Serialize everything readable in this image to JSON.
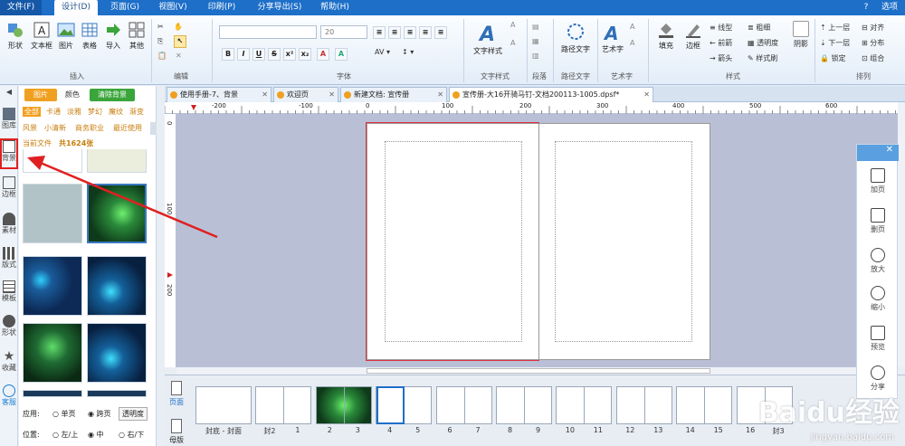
{
  "menubar": {
    "tabs": [
      "文件(F)",
      "设计(D)",
      "页面(G)",
      "视图(V)",
      "印刷(P)",
      "分享导出(S)",
      "帮助(H)"
    ],
    "right": "选项"
  },
  "ribbon": {
    "insert": {
      "buttons": [
        "形状",
        "文本框",
        "图片",
        "表格",
        "导入",
        "其他"
      ],
      "label": "插入"
    },
    "edit_label": "编辑",
    "font": {
      "size": "20",
      "label": "字体"
    },
    "text_style": {
      "button": "文字样式",
      "label": "文字样式"
    },
    "paragraph_label": "段落",
    "path_text": {
      "button": "路径文字",
      "label": "路径文字"
    },
    "art_text": {
      "button": "艺术字",
      "label": "艺术字"
    },
    "style": {
      "fill": "填充",
      "border": "边框",
      "line_type": "线型",
      "thickness": "粗细",
      "front_arrow": "前箭",
      "back_arrow": "后箭",
      "arrow": "箭头",
      "transparency": "透明度",
      "style_copy": "样式刷",
      "label": "样式"
    },
    "shadow": "阴影",
    "arrange": {
      "up": "上一层",
      "down": "下一层",
      "lock": "锁定",
      "align": "对齐",
      "distribute": "分布",
      "combine": "组合",
      "label": "排列"
    }
  },
  "leftstrip": [
    "图库",
    "背景",
    "边框",
    "素材",
    "版式",
    "模板",
    "形状",
    "收藏",
    "客服"
  ],
  "panel": {
    "tabs": [
      "图片",
      "颜色",
      "清除背景"
    ],
    "categories": [
      "全部",
      "卡通",
      "淡雅",
      "梦幻",
      "魔纹",
      "渐变",
      "风景",
      "小清新",
      "商务职业",
      "最近使用",
      "当前文件"
    ],
    "count": "共1624张",
    "apply_label": "应用:",
    "apply_options": [
      "单页",
      "跨页",
      "透明度"
    ],
    "position_label": "位置:",
    "position_options": [
      "左/上",
      "中",
      "右/下"
    ]
  },
  "doc_tabs": [
    "使用手册-7、背景",
    "欢迎页",
    "新建文档: 宣传册",
    "宣传册-大16开骑马钉-文档200113-1005.dpsf*"
  ],
  "ruler_marks": [
    "-200",
    "-100",
    "0",
    "100",
    "200",
    "300",
    "400",
    "500",
    "600"
  ],
  "ruler_v_marks": [
    "0",
    "100",
    "200"
  ],
  "pagebar": {
    "side": [
      "页面",
      "母版"
    ],
    "labels": [
      "封底 - 封面",
      "封2",
      "1",
      "2",
      "3",
      "4",
      "5",
      "6",
      "7",
      "8",
      "9",
      "10",
      "11",
      "12",
      "13",
      "14",
      "15",
      "16",
      "封3"
    ]
  },
  "right_panel": [
    "加页",
    "删页",
    "放大",
    "缩小",
    "预览",
    "分享"
  ],
  "watermark": {
    "main": "Baidu经验",
    "sub": "jingyan.baidu.com"
  },
  "colors": {
    "menubar": "#1d6fc8",
    "accent_orange": "#f0a020",
    "highlight_red": "#e02020",
    "canvas": "#b9c0d6"
  }
}
